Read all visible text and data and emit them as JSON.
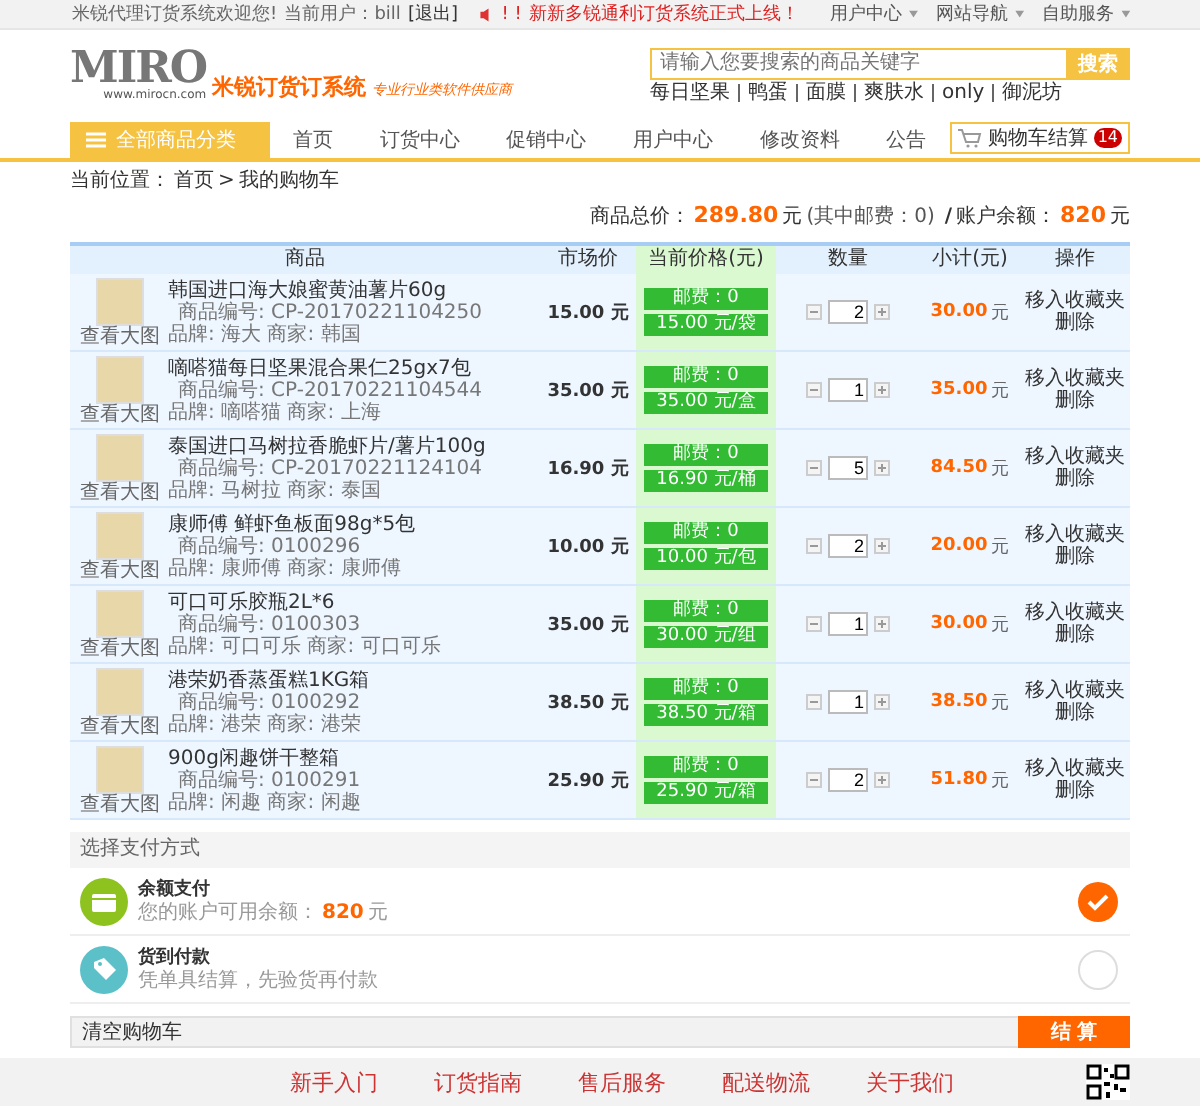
{
  "top_bar": {
    "welcome": "米锐代理订货系统欢迎您!",
    "user": "当前用户：bill",
    "logout": "[退出]",
    "notice_marks": "! !",
    "notice": "新新多锐通利订货系统正式上线！",
    "links": [
      "用户中心",
      "网站导航",
      "自助服务"
    ]
  },
  "logo": {
    "brand": "MIRO",
    "url": "www.mirocn.com",
    "name": "米锐订货订系统",
    "slogan": "专业行业类软件供应商"
  },
  "search": {
    "placeholder": "请输入您要搜索的商品关键字",
    "button": "搜索",
    "hot": [
      "每日坚果",
      "鸭蛋",
      "面膜",
      "爽肤水",
      "only",
      "御泥坊"
    ]
  },
  "nav": {
    "category": "全部商品分类",
    "items": [
      "首页",
      "订货中心",
      "促销中心",
      "用户中心",
      "修改资料",
      "公告"
    ],
    "cart": "购物车结算",
    "cart_count": "14"
  },
  "breadcrumb": {
    "label": "当前位置：",
    "home": "首页",
    "sep": ">",
    "current": "我的购物车"
  },
  "summary": {
    "total_label": "商品总价：",
    "total": "289.80",
    "unit": "元",
    "postage": "(其中邮费：0)",
    "sep": "/",
    "balance_label": "账户余额：",
    "balance": "820",
    "balance_unit": "元"
  },
  "table": {
    "columns": [
      "商品",
      "市场价",
      "当前价格(元)",
      "数量",
      "小计(元)",
      "操作"
    ],
    "rows": [
      {
        "name": "韩国进口海大娘蜜黄油薯片60g",
        "code": "商品编号: CP-20170221104250",
        "brand": "品牌: 海大  商家: 韩国",
        "view": "查看大图",
        "market": "15.00 元",
        "postage": "邮费：0",
        "price": "15.00 元/袋",
        "qty": "2",
        "subtotal": "30.00",
        "unit": "元",
        "fav": "移入收藏夹",
        "del": "删除"
      },
      {
        "name": "嘀嗒猫每日坚果混合果仁25gx7包",
        "code": "商品编号: CP-20170221104544",
        "brand": "品牌: 嘀嗒猫  商家: 上海",
        "view": "查看大图",
        "market": "35.00 元",
        "postage": "邮费：0",
        "price": "35.00 元/盒",
        "qty": "1",
        "subtotal": "35.00",
        "unit": "元",
        "fav": "移入收藏夹",
        "del": "删除"
      },
      {
        "name": "泰国进口马树拉香脆虾片/薯片100g",
        "code": "商品编号: CP-20170221124104",
        "brand": "品牌: 马树拉  商家: 泰国",
        "view": "查看大图",
        "market": "16.90 元",
        "postage": "邮费：0",
        "price": "16.90 元/桶",
        "qty": "5",
        "subtotal": "84.50",
        "unit": "元",
        "fav": "移入收藏夹",
        "del": "删除"
      },
      {
        "name": "康师傅 鲜虾鱼板面98g*5包",
        "code": "商品编号: 0100296",
        "brand": "品牌: 康师傅  商家: 康师傅",
        "view": "查看大图",
        "market": "10.00 元",
        "postage": "邮费：0",
        "price": "10.00 元/包",
        "qty": "2",
        "subtotal": "20.00",
        "unit": "元",
        "fav": "移入收藏夹",
        "del": "删除"
      },
      {
        "name": "可口可乐胶瓶2L*6",
        "code": "商品编号: 0100303",
        "brand": "品牌: 可口可乐  商家: 可口可乐",
        "view": "查看大图",
        "market": "35.00 元",
        "postage": "邮费：0",
        "price": "30.00 元/组",
        "qty": "1",
        "subtotal": "30.00",
        "unit": "元",
        "fav": "移入收藏夹",
        "del": "删除"
      },
      {
        "name": "港荣奶香蒸蛋糕1KG箱",
        "code": "商品编号: 0100292",
        "brand": "品牌: 港荣  商家: 港荣",
        "view": "查看大图",
        "market": "38.50 元",
        "postage": "邮费：0",
        "price": "38.50 元/箱",
        "qty": "1",
        "subtotal": "38.50",
        "unit": "元",
        "fav": "移入收藏夹",
        "del": "删除"
      },
      {
        "name": "900g闲趣饼干整箱",
        "code": "商品编号: 0100291",
        "brand": "品牌: 闲趣  商家: 闲趣",
        "view": "查看大图",
        "market": "25.90 元",
        "postage": "邮费：0",
        "price": "25.90 元/箱",
        "qty": "2",
        "subtotal": "51.80",
        "unit": "元",
        "fav": "移入收藏夹",
        "del": "删除"
      }
    ]
  },
  "payment": {
    "title": "选择支付方式",
    "options": [
      {
        "kind": "balance",
        "title": "余额支付",
        "desc": "您的账户可用余额：",
        "amount": "820",
        "unit": "元",
        "selected": true
      },
      {
        "kind": "cod",
        "title": "货到付款",
        "desc": "凭单具结算，先验货再付款",
        "selected": false
      }
    ]
  },
  "actions": {
    "clear": "清空购物车",
    "checkout": "结 算"
  },
  "footer": {
    "links": [
      "新手入门",
      "订货指南",
      "售后服务",
      "配送物流",
      "关于我们"
    ]
  }
}
